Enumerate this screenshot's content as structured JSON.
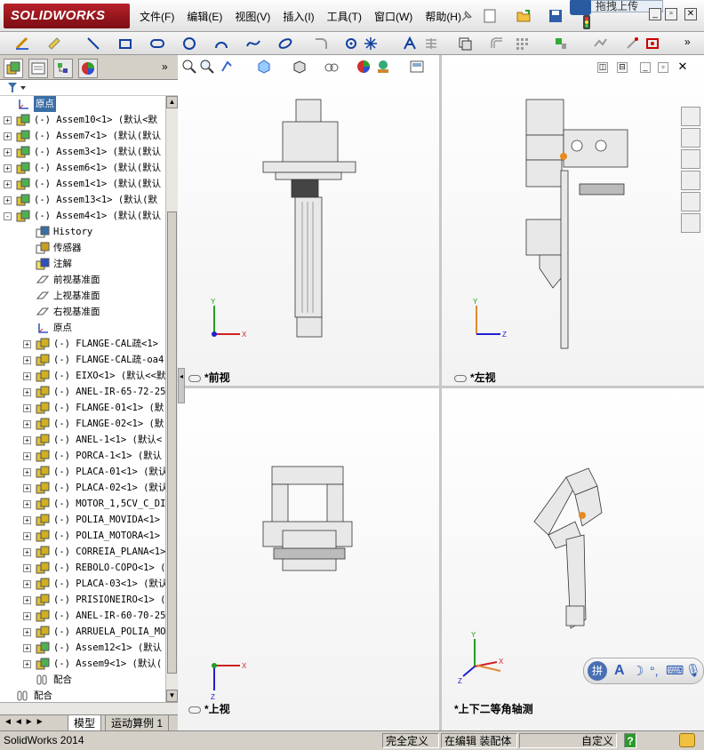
{
  "app": {
    "logo": "SOLIDWORKS"
  },
  "menu": [
    "文件(F)",
    "编辑(E)",
    "视图(V)",
    "插入(I)",
    "工具(T)",
    "窗口(W)",
    "帮助(H)"
  ],
  "upload_label": "拖拽上传",
  "tree": {
    "items": [
      {
        "label": "原点",
        "level": 0,
        "icon": "origin-icon",
        "selected": true
      },
      {
        "label": "(-) Assem10<1> (默认<默",
        "level": 0,
        "icon": "assembly-icon",
        "expander": "+"
      },
      {
        "label": "(-) Assem7<1> (默认(默认",
        "level": 0,
        "icon": "assembly-icon",
        "expander": "+"
      },
      {
        "label": "(-) Assem3<1> (默认(默认",
        "level": 0,
        "icon": "assembly-icon",
        "expander": "+"
      },
      {
        "label": "(-) Assem6<1> (默认(默认",
        "level": 0,
        "icon": "assembly-icon",
        "expander": "+"
      },
      {
        "label": "(-) Assem1<1> (默认(默认",
        "level": 0,
        "icon": "assembly-icon",
        "expander": "+"
      },
      {
        "label": "(-) Assem13<1> (默认(默",
        "level": 0,
        "icon": "assembly-icon",
        "expander": "+"
      },
      {
        "label": "(-) Assem4<1> (默认(默认",
        "level": 0,
        "icon": "assembly-icon",
        "expander": "-"
      },
      {
        "label": "History",
        "level": 1,
        "icon": "history-icon"
      },
      {
        "label": "传感器",
        "level": 1,
        "icon": "sensor-icon"
      },
      {
        "label": "注解",
        "level": 1,
        "icon": "annotation-icon"
      },
      {
        "label": "前视基准面",
        "level": 1,
        "icon": "plane-icon"
      },
      {
        "label": "上视基准面",
        "level": 1,
        "icon": "plane-icon"
      },
      {
        "label": "右视基准面",
        "level": 1,
        "icon": "plane-icon"
      },
      {
        "label": "原点",
        "level": 1,
        "icon": "origin-icon"
      },
      {
        "label": "(-) FLANGE-CAL疏<1>",
        "level": 1,
        "icon": "part-icon",
        "expander": "+"
      },
      {
        "label": "(-) FLANGE-CAL疏-oa4",
        "level": 1,
        "icon": "part-icon",
        "expander": "+"
      },
      {
        "label": "(-) EIXO<1> (默认<<默",
        "level": 1,
        "icon": "part-icon",
        "expander": "+"
      },
      {
        "label": "(-) ANEL-IR-65-72-25",
        "level": 1,
        "icon": "part-icon",
        "expander": "+"
      },
      {
        "label": "(-) FLANGE-01<1> (默",
        "level": 1,
        "icon": "part-icon",
        "expander": "+"
      },
      {
        "label": "(-) FLANGE-02<1> (默",
        "level": 1,
        "icon": "part-icon",
        "expander": "+"
      },
      {
        "label": "(-) ANEL-1<1> (默认<",
        "level": 1,
        "icon": "part-icon",
        "expander": "+"
      },
      {
        "label": "(-) PORCA-1<1> (默认",
        "level": 1,
        "icon": "part-icon",
        "expander": "+"
      },
      {
        "label": "(-) PLACA-01<1> (默认",
        "level": 1,
        "icon": "part-icon",
        "expander": "+"
      },
      {
        "label": "(-) PLACA-02<1> (默认",
        "level": 1,
        "icon": "part-icon",
        "expander": "+"
      },
      {
        "label": "(-) MOTOR_1,5CV_C_DI",
        "level": 1,
        "icon": "part-icon",
        "expander": "+"
      },
      {
        "label": "(-) POLIA_MOVIDA<1>",
        "level": 1,
        "icon": "part-icon",
        "expander": "+"
      },
      {
        "label": "(-) POLIA_MOTORA<1>",
        "level": 1,
        "icon": "part-icon",
        "expander": "+"
      },
      {
        "label": "(-) CORREIA_PLANA<1>",
        "level": 1,
        "icon": "part-icon",
        "expander": "+"
      },
      {
        "label": "(-) REBOLO-COPO<1> (",
        "level": 1,
        "icon": "part-icon",
        "expander": "+"
      },
      {
        "label": "(-) PLACA-03<1> (默认",
        "level": 1,
        "icon": "part-icon",
        "expander": "+"
      },
      {
        "label": "(-) PRISIONEIRO<1> (",
        "level": 1,
        "icon": "part-icon",
        "expander": "+"
      },
      {
        "label": "(-) ANEL-IR-60-70-25",
        "level": 1,
        "icon": "part-icon",
        "expander": "+"
      },
      {
        "label": "(-) ARRUELA_POLIA_MO",
        "level": 1,
        "icon": "part-icon",
        "expander": "+"
      },
      {
        "label": "(-) Assem12<1> (默认",
        "level": 1,
        "icon": "assembly-icon",
        "expander": "+"
      },
      {
        "label": "(-) Assem9<1> (默认(",
        "level": 1,
        "icon": "assembly-icon",
        "expander": "+"
      },
      {
        "label": "配合",
        "level": 1,
        "icon": "mate-icon"
      },
      {
        "label": "配合",
        "level": 0,
        "icon": "mate-icon"
      }
    ]
  },
  "bottom_tabs": [
    "模型",
    "运动算例 1"
  ],
  "viewports": [
    {
      "label": "*前视",
      "axes": [
        "Y",
        "X"
      ]
    },
    {
      "label": "*左视",
      "axes": [
        "Y",
        "Z"
      ]
    },
    {
      "label": "*上视",
      "axes": [
        "Z",
        "X"
      ]
    },
    {
      "label": "*上下二等角轴测",
      "axes": [
        "Y",
        "X",
        "Z"
      ]
    }
  ],
  "status": {
    "app": "SolidWorks 2014",
    "definition": "完全定义",
    "editing": "在编辑 装配体",
    "units": "自定义",
    "help": "?"
  },
  "colors": {
    "accent": "#3a6ea5",
    "brand": "#b8212a",
    "axis_x": "#d02020",
    "axis_y": "#20a020",
    "axis_z": "#2020d0"
  }
}
